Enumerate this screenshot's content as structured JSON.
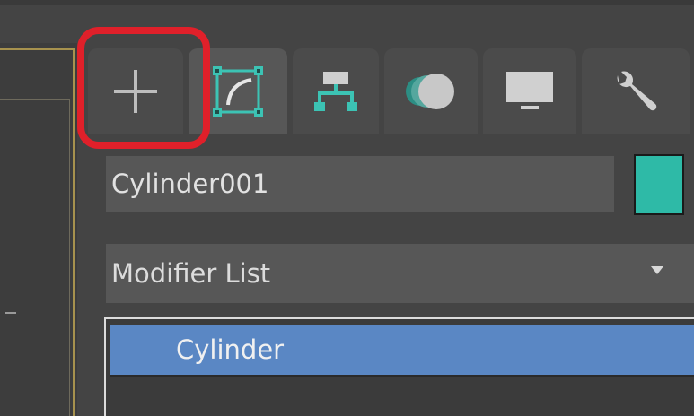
{
  "command_panel": {
    "tabs": [
      {
        "id": "create",
        "icon": "plus-icon",
        "active": false
      },
      {
        "id": "modify",
        "icon": "modify-curve-icon",
        "active": true
      },
      {
        "id": "hierarchy",
        "icon": "hierarchy-icon",
        "active": false
      },
      {
        "id": "motion",
        "icon": "motion-icon",
        "active": false
      },
      {
        "id": "display",
        "icon": "display-monitor-icon",
        "active": false
      },
      {
        "id": "utilities",
        "icon": "wrench-icon",
        "active": false
      }
    ],
    "object_name": "Cylinder001",
    "object_color": "#2ebaa7",
    "modifier_list_label": "Modifier List",
    "modifier_stack": [
      {
        "label": "Cylinder",
        "selected": true
      }
    ]
  },
  "colors": {
    "accent_highlight": "#e0202a",
    "teal_icon": "#3cc3b4",
    "selection_blue": "#5a87c4",
    "viewport_frame": "#a7924e"
  }
}
